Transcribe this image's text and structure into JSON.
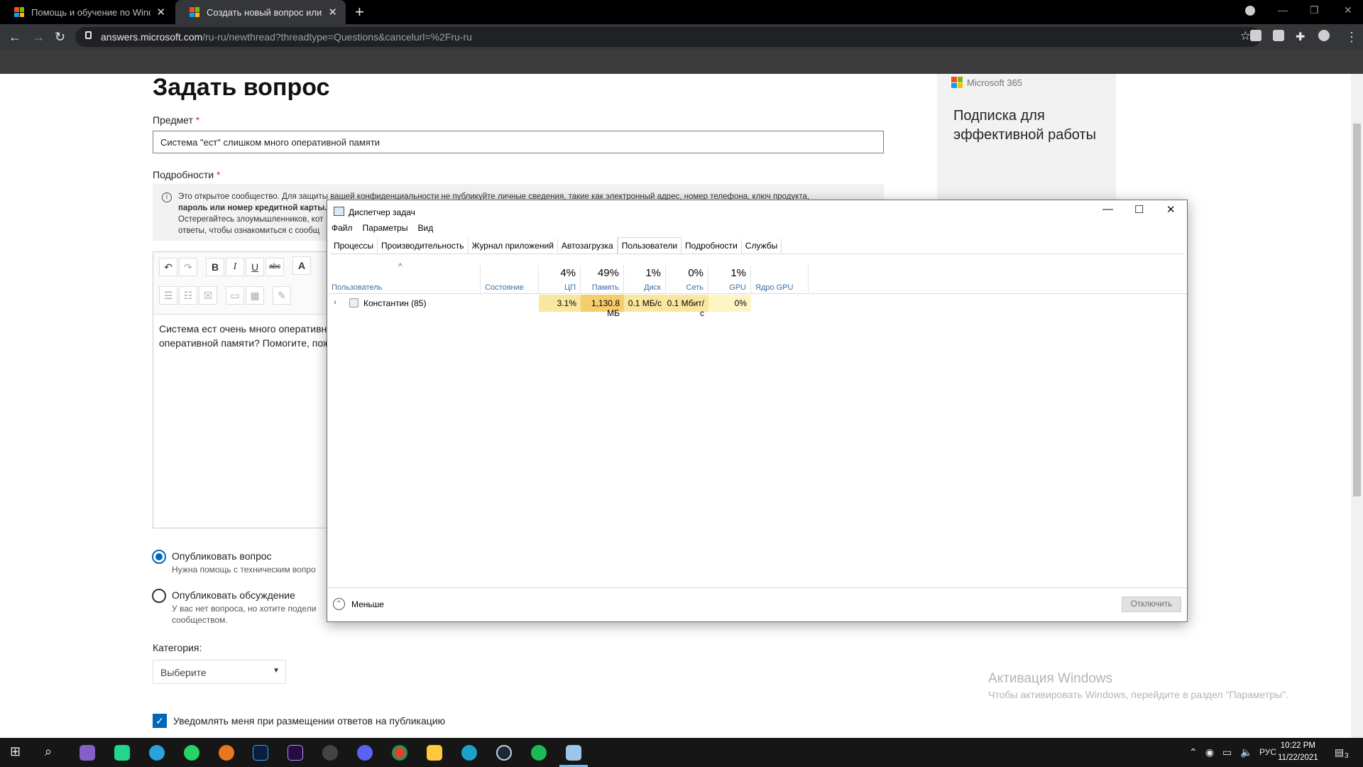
{
  "browser": {
    "tabs": [
      {
        "title": "Помощь и обучение по Windows"
      },
      {
        "title": "Создать новый вопрос или начать обсуждение"
      }
    ],
    "new_tab": "+",
    "url_host": "answers.microsoft.com",
    "url_path": "/ru-ru/newthread?threadtype=Questions&cancelurl=%2Fru-ru"
  },
  "page": {
    "title": "Задать вопрос",
    "subject_label": "Предмет",
    "subject_value": "Система \"ест\" слишком много оперативной памяти",
    "details_label": "Подробности",
    "required_mark": "*",
    "notice_line1": "Это открытое сообщество. Для защиты вашей конфиденциальности не публикуйте личные сведения, такие как электронный адрес, номер телефона, ключ продукта,",
    "notice_line2": "пароль или номер кредитной карты.",
    "notice_line3": "Остерегайтесь злоумышленников, кот",
    "notice_line4": "ответы, чтобы ознакомиться с сообщ",
    "editor_text_line1": "Система ест очень много оперативн",
    "editor_text_line2": "оперативной памяти? Помогите, пож",
    "publish_question": "Опубликовать вопрос",
    "publish_question_hint": "Нужна помощь с техническим вопро",
    "publish_discussion": "Опубликовать обсуждение",
    "publish_discussion_hint1": "У вас нет вопроса, но хотите подели",
    "publish_discussion_hint2": "сообществом.",
    "category_label": "Категория:",
    "category_value": "Выберите",
    "notify_label": "Уведомлять меня при размещении ответов на публикацию"
  },
  "ad": {
    "brand": "Microsoft 365",
    "text": "Подписка для эффективной работы"
  },
  "activation": {
    "title": "Активация Windows",
    "subtitle": "Чтобы активировать Windows, перейдите в раздел \"Параметры\"."
  },
  "task_manager": {
    "title": "Диспетчер задач",
    "menu": [
      "Файл",
      "Параметры",
      "Вид"
    ],
    "tabs": [
      "Процессы",
      "Производительность",
      "Журнал приложений",
      "Автозагрузка",
      "Пользователи",
      "Подробности",
      "Службы"
    ],
    "active_tab": "Пользователи",
    "columns": {
      "user": "Пользователь",
      "status": "Состояние",
      "cpu": {
        "name": "ЦП",
        "pct": "4%"
      },
      "memory": {
        "name": "Память",
        "pct": "49%"
      },
      "disk": {
        "name": "Диск",
        "pct": "1%"
      },
      "network": {
        "name": "Сеть",
        "pct": "0%"
      },
      "gpu": {
        "name": "GPU",
        "pct": "1%"
      },
      "gpu_engine": "Ядро GPU"
    },
    "row": {
      "user": "Константин (85)",
      "status": "",
      "cpu": "3.1%",
      "memory": "1,130.8 МБ",
      "disk": "0.1 МБ/с",
      "network": "0.1 Мбит/с",
      "gpu": "0%",
      "gpu_engine": ""
    },
    "fewer_details": "Меньше",
    "disconnect": "Отключить",
    "heat_colors": {
      "light": "#fff4c4",
      "medium": "#f9e79f",
      "strong": "#f6cd6d"
    }
  },
  "taskbar": {
    "language": "РУС",
    "time": "10:22 PM",
    "date": "11/22/2021",
    "notifications": "3"
  }
}
